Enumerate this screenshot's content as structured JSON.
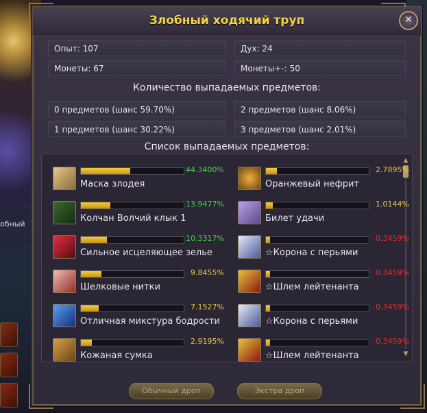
{
  "window": {
    "title": "Злобный ходячий труп",
    "close_label": "✕"
  },
  "stats": {
    "exp": "Опыт: 107",
    "spirit": "Дух: 24",
    "coins": "Монеты: 67",
    "coins_plus": "Монеты+-: 50"
  },
  "drop_count": {
    "heading": "Количество выпадаемых предметов:",
    "rows": [
      "0 предметов (шанс 59.70%)",
      "2 предметов (шанс 8.06%)",
      "1 предметов (шанс 30.22%)",
      "3 предметов (шанс 2.01%)"
    ]
  },
  "drop_list": {
    "heading": "Список выпадаемых предметов:",
    "items": [
      {
        "name": "Маска злодея",
        "pct": "44.3400%",
        "fill": 0.443,
        "pct_color": "#3fd93f",
        "icon": "mask-icon"
      },
      {
        "name": "Оранжевый нефрит",
        "pct": "2.7895%",
        "fill": 0.028,
        "pct_color": "#e8c84a",
        "icon": "jade-icon"
      },
      {
        "name": "Колчан Волчий клык 1",
        "pct": "13.9477%",
        "fill": 0.139,
        "pct_color": "#3fd93f",
        "icon": "quiver-icon"
      },
      {
        "name": "Билет удачи",
        "pct": "1.0144%",
        "fill": 0.01,
        "pct_color": "#e8c84a",
        "icon": "ticket-icon"
      },
      {
        "name": "Сильное исцеляющее зелье",
        "pct": "10.3317%",
        "fill": 0.103,
        "pct_color": "#3fd93f",
        "icon": "red-potion-icon"
      },
      {
        "name": "☆Корона с перьями",
        "pct": "0.3459%",
        "fill": 0.0035,
        "pct_color": "#e03030",
        "icon": "feather-crown-icon"
      },
      {
        "name": "Шелковые нитки",
        "pct": "9.8455%",
        "fill": 0.098,
        "pct_color": "#e8c84a",
        "icon": "silk-thread-icon"
      },
      {
        "name": "☆Шлем лейтенанта",
        "pct": "0.3459%",
        "fill": 0.0035,
        "pct_color": "#e03030",
        "icon": "lieutenant-helmet-icon"
      },
      {
        "name": "Отличная микстура бодрости",
        "pct": "7.1527%",
        "fill": 0.072,
        "pct_color": "#e8c84a",
        "icon": "blue-potion-icon"
      },
      {
        "name": "☆Корона с перьями",
        "pct": "0.3459%",
        "fill": 0.0035,
        "pct_color": "#e03030",
        "icon": "feather-crown-icon"
      },
      {
        "name": "Кожаная сумка",
        "pct": "2.9195%",
        "fill": 0.029,
        "pct_color": "#e8c84a",
        "icon": "leather-bag-icon"
      },
      {
        "name": "☆Шлем лейтенанта",
        "pct": "0.3459%",
        "fill": 0.0035,
        "pct_color": "#e03030",
        "icon": "lieutenant-helmet-icon"
      }
    ]
  },
  "buttons": {
    "normal_drop": "Обычный дроп",
    "extra_drop": "Экстра дроп"
  },
  "background": {
    "left_text": "обный"
  },
  "colors": {
    "title": "#f2d34a",
    "bar_fill": "#f4cc3c",
    "pct_high": "#3fd93f",
    "pct_mid": "#e8c84a",
    "pct_low": "#e03030"
  }
}
